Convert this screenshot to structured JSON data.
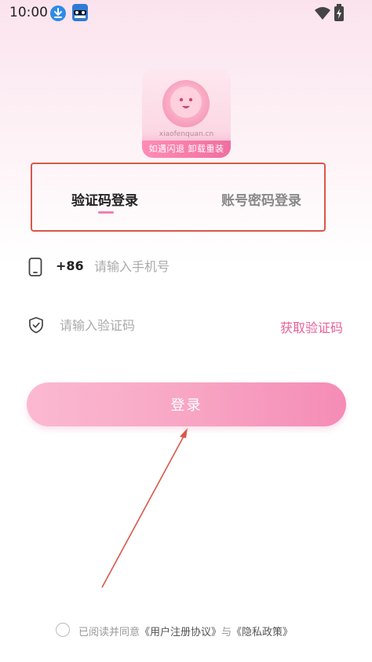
{
  "status_bar": {
    "time": "10:00"
  },
  "logo": {
    "url_text": "xiaofenquan.cn",
    "slogan": "如遇闪退  卸载重装"
  },
  "tabs": [
    {
      "label": "验证码登录",
      "active": true
    },
    {
      "label": "账号密码登录",
      "active": false
    }
  ],
  "phone": {
    "country_code": "+86",
    "placeholder": "请输入手机号",
    "value": ""
  },
  "code": {
    "placeholder": "请输入验证码",
    "value": "",
    "get_code_label": "获取验证码"
  },
  "login_button": {
    "label": "登录"
  },
  "agreement": {
    "prefix": "已阅读并同意",
    "user_agreement": "《用户注册协议》",
    "joiner": "与",
    "privacy_policy": "《隐私政策》",
    "checked": false
  },
  "colors": {
    "accent": "#e8609a",
    "annotation": "#d9574a",
    "button": "#f8a6c4"
  }
}
